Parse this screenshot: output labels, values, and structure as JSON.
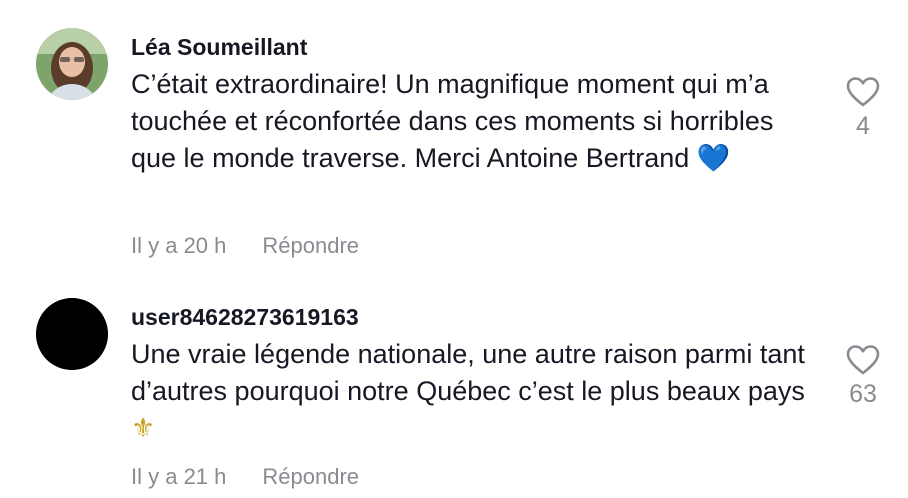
{
  "comments": [
    {
      "username": "Léa Soumeillant",
      "text": "C’était extraordinaire! Un magnifique moment qui m’a touchée et réconfortée dans ces moments si horribles que le monde traverse. Merci Antoine Bertrand",
      "emoji": "💙",
      "time": "Il y a 20 h",
      "reply_label": "Répondre",
      "likes": "4"
    },
    {
      "username": "user84628273619163",
      "text": "Une vraie légende nationale, une autre raison parmi tant d’autres pourquoi notre Québec c’est le plus beaux pays",
      "emoji": "⚜",
      "time": "Il y a 21 h",
      "reply_label": "Répondre",
      "likes": "63"
    }
  ],
  "colors": {
    "text": "#161823",
    "secondary": "#8a8b91",
    "heart_emoji": "#3d8fe8",
    "fleur_de_lis": "#c9a227"
  },
  "icons": {
    "like": "heart-outline-icon",
    "avatar_1": "photo-avatar",
    "avatar_2": "black-avatar"
  }
}
